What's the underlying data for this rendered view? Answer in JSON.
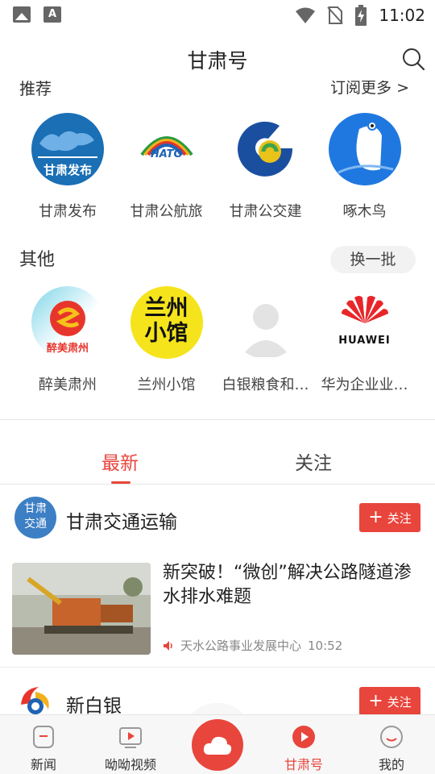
{
  "status_bar": {
    "time": "11:02"
  },
  "header": {
    "title": "甘肃号"
  },
  "recommended": {
    "title": "推荐",
    "more_label": "订阅更多 >",
    "items": [
      {
        "label": "甘肃发布",
        "logo_text": "甘肃发布"
      },
      {
        "label": "甘肃公航旅",
        "logo_text": "HATG"
      },
      {
        "label": "甘肃公交建"
      },
      {
        "label": "啄木鸟"
      }
    ]
  },
  "other": {
    "title": "其他",
    "swap_label": "换一批",
    "items": [
      {
        "label": "醉美肃州",
        "logo_text": "醉美肃州"
      },
      {
        "label": "兰州小馆",
        "logo_text_1": "兰州",
        "logo_text_2": "小馆"
      },
      {
        "label": "白银粮食和…"
      },
      {
        "label": "华为企业业…",
        "logo_text": "HUAWEI"
      }
    ]
  },
  "tabs": [
    {
      "label": "最新",
      "active": true
    },
    {
      "label": "关注",
      "active": false
    }
  ],
  "feed": {
    "accounts": [
      {
        "name": "甘肃交通运输",
        "avatar_text_1": "甘肃",
        "avatar_text_2": "交通",
        "follow_label": "关注"
      },
      {
        "name": "新白银",
        "follow_label": "关注"
      }
    ],
    "article": {
      "title": "新突破！“微创”解决公路隧道渗水排水难题",
      "source": "天水公路事业发展中心",
      "time": "10:52"
    }
  },
  "bottom_nav": [
    {
      "label": "新闻",
      "icon": "news-icon"
    },
    {
      "label": "呦呦视频",
      "icon": "video-icon"
    },
    {
      "label": "甘肃号",
      "icon": "play-circle-icon",
      "active": true
    },
    {
      "label": "我的",
      "icon": "profile-icon"
    }
  ],
  "colors": {
    "accent": "#e8453c",
    "text": "#222222",
    "muted": "#888888"
  }
}
